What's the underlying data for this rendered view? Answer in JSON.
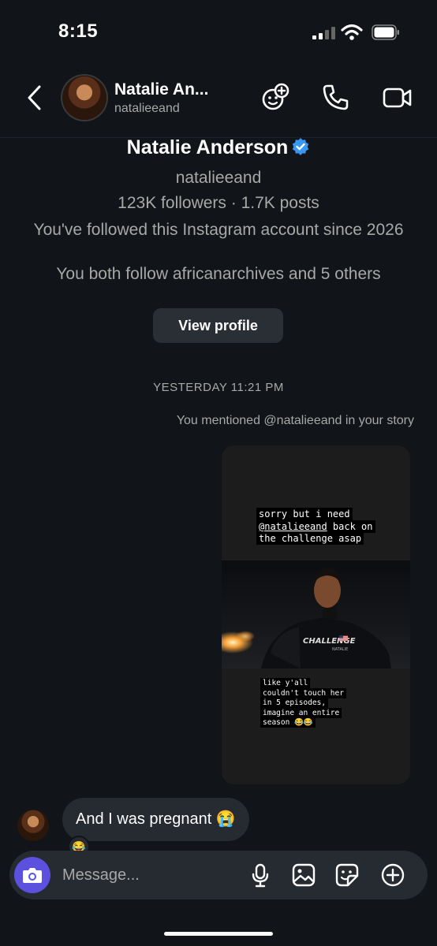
{
  "status_bar": {
    "time": "8:15"
  },
  "header": {
    "name": "Natalie An...",
    "username": "natalieeand"
  },
  "profile": {
    "name": "Natalie Anderson",
    "username": "natalieeand",
    "stats": "123K followers · 1.7K posts",
    "since": "You've followed this Instagram account since 2026",
    "mutual": "You both follow africanarchives and 5 others",
    "view_button": "View profile"
  },
  "thread": {
    "timestamp": "YESTERDAY 11:21 PM",
    "mention_note": "You mentioned @natalieeand in your story",
    "story": {
      "caption_line1": "sorry but i need",
      "caption_handle": "@natalieeand",
      "caption_line1_end": " back on",
      "caption_line3": "the challenge asap",
      "shirt_text": "CHALLENGE",
      "shirt_subtext": "NATALIE",
      "caption2": "like y'all couldn't touch her in 5 episodes, imagine an entire season 😂😂"
    },
    "incoming_message": "And I was pregnant 😭",
    "reaction": "😂"
  },
  "composer": {
    "placeholder": "Message..."
  },
  "colors": {
    "background": "#111418",
    "bubble": "#262a31",
    "camera": "#5b51de",
    "verified": "#3897f0"
  }
}
